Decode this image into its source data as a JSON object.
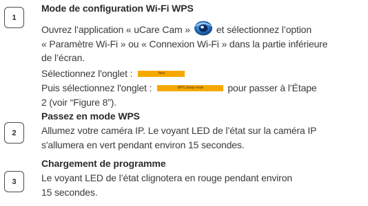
{
  "steps": [
    {
      "number": "1",
      "title": "Mode de configuration Wi-Fi WPS",
      "line1_before_icon": "Ouvrez l’application « uCare Cam »",
      "line1_after_icon": "et sélectionnez l’option",
      "line2": "« Paramètre Wi-Fi » ou « Connexion Wi-Fi » dans la partie inférieure",
      "line3": "de l’écran.",
      "line4": "Sélectionnez l'onglet :",
      "tab1_label": "Next",
      "line5_before": "Puis sélectionnez l'onglet :",
      "tab2_label": "WPS Setup mode",
      "line5_after": "pour passer à l’Étape",
      "line6": "2 (voir “Figure 8”)."
    },
    {
      "number": "2",
      "title": "Passez en mode WPS",
      "line1": "Allumez votre caméra IP. Le voyant LED de l’état sur la caméra IP",
      "line2": "s'allumera en vert pendant environ 15 secondes."
    },
    {
      "number": "3",
      "title": "Chargement de programme",
      "line1": "Le voyant LED de l’état clignotera en rouge pendant environ",
      "line2": "15 secondes."
    }
  ],
  "icons": {
    "app": "ucare-cam-app-icon"
  },
  "colors": {
    "tab_orange": "#f5a800",
    "text": "#3a3a3a"
  }
}
